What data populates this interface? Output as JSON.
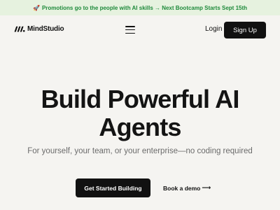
{
  "promo_bar": {
    "icon": "rocket-icon",
    "text": "Promotions go to the people with AI skills → Next Bootcamp Starts Sept 15th",
    "color": "#1f8a3b",
    "background": "#e6f2df"
  },
  "nav": {
    "logo_icon": "mindstudio-logo-icon",
    "logo_text": "MindStudio",
    "menu_icon": "hamburger-menu-icon",
    "login_label": "Login",
    "signup_label": "Sign Up"
  },
  "hero": {
    "title_line1": "Build Powerful AI",
    "title_line2": "Agents",
    "subtitle": "For yourself, your team, or your enterprise—no coding required",
    "primary_cta": "Get Started Building",
    "secondary_cta": "Book a demo",
    "secondary_cta_icon": "arrow-right-icon"
  },
  "colors": {
    "page_background": "#f5f4f1",
    "button_dark": "#111111",
    "text_muted": "#6b6b6b"
  }
}
